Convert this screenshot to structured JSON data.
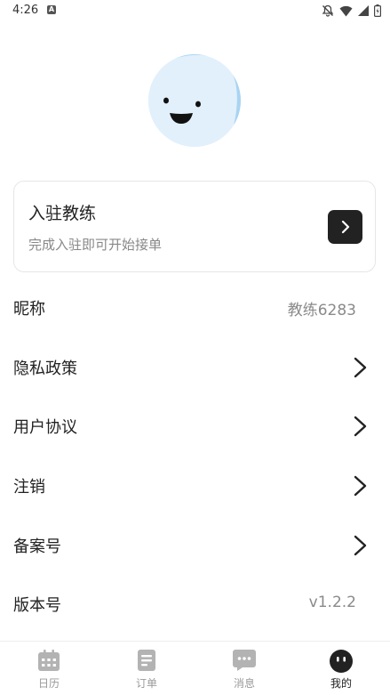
{
  "status_bar": {
    "time": "4:26",
    "notification_icon": "a-badge-icon",
    "icons": [
      "bell-off-icon",
      "wifi-icon",
      "signal-icon",
      "battery-icon"
    ]
  },
  "profile": {
    "avatar_icon": "smiley-avatar-icon"
  },
  "join_card": {
    "title": "入驻教练",
    "subtitle": "完成入驻即可开始接单",
    "arrow_icon": "chevron-right-icon"
  },
  "settings": [
    {
      "label": "昵称",
      "value": "教练6283"
    },
    {
      "label": "隐私政策"
    },
    {
      "label": "用户协议"
    },
    {
      "label": "注销"
    },
    {
      "label": "备案号"
    },
    {
      "label": "版本号",
      "value": "v1.2.2"
    }
  ],
  "bottom_nav": [
    {
      "label": "日历",
      "icon": "calendar-icon",
      "active": false
    },
    {
      "label": "订单",
      "icon": "document-icon",
      "active": false
    },
    {
      "label": "消息",
      "icon": "chat-bubble-icon",
      "active": false
    },
    {
      "label": "我的",
      "icon": "smiley-face-icon",
      "active": true
    }
  ],
  "colors": {
    "accent": "#222222",
    "inactive": "#b3b3b3",
    "avatar_bg": "#e2f0fb",
    "avatar_face": "#a9d4f2"
  }
}
